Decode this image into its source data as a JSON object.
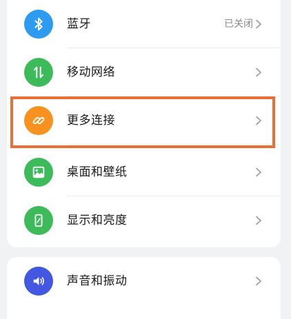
{
  "settings": {
    "items": [
      {
        "label": "蓝牙",
        "status": "已关闭",
        "icon": "bluetooth-icon",
        "icon_color": "#2d9cf0"
      },
      {
        "label": "移动网络",
        "status": "",
        "icon": "mobile-data-icon",
        "icon_color": "#3dba5a"
      },
      {
        "label": "更多连接",
        "status": "",
        "icon": "link-icon",
        "icon_color": "#f7921e"
      },
      {
        "label": "桌面和壁纸",
        "status": "",
        "icon": "wallpaper-icon",
        "icon_color": "#3dba5a"
      },
      {
        "label": "显示和亮度",
        "status": "",
        "icon": "display-icon",
        "icon_color": "#3dba5a"
      },
      {
        "label": "声音和振动",
        "status": "",
        "icon": "sound-icon",
        "icon_color": "#4357e0"
      }
    ]
  },
  "highlight": {
    "target": "更多连接",
    "color": "#ea6f37"
  }
}
